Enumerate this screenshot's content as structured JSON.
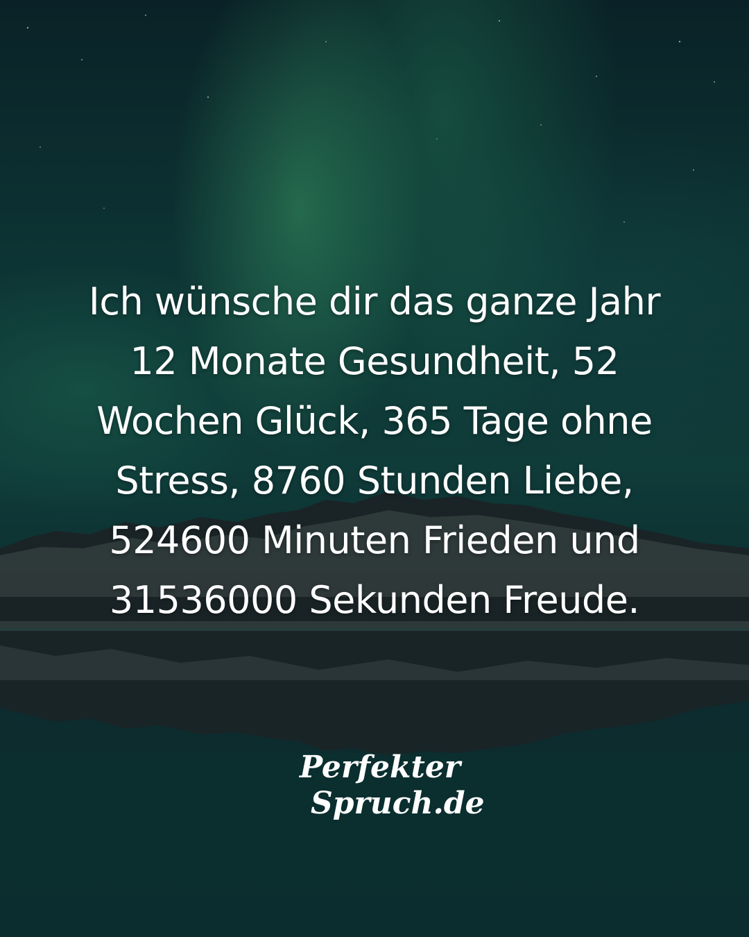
{
  "quote": {
    "lines": [
      "Ich wünsche dir das ganze Jahr",
      "12 Monate Gesundheit, 52",
      "Wochen Glück, 365 Tage ohne",
      "Stress, 8760 Stunden Liebe,",
      "524600 Minuten Frieden und",
      "31536000 Sekunden Freude."
    ]
  },
  "logo": {
    "line1": "Perfekter",
    "line2": "Spruch.de"
  },
  "colors": {
    "text": "#ffffff",
    "sky_dark": "#0a2227",
    "aurora_green": "#40aa6e",
    "mountains": "#1a2226"
  }
}
